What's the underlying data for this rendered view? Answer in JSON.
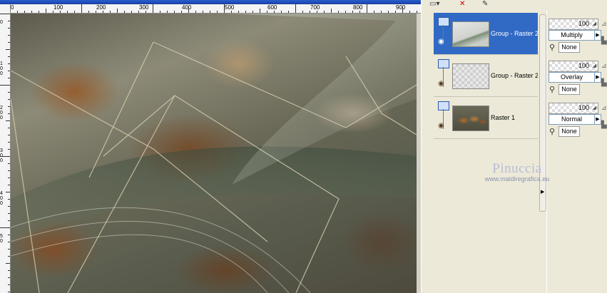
{
  "ruler": {
    "top_labels": [
      "0",
      "100",
      "200",
      "300",
      "400",
      "500",
      "600",
      "700",
      "800",
      "900"
    ],
    "left_labels": [
      "0",
      "1 0 0",
      "2 0 0",
      "3 0 0",
      "4 0 0",
      "5 0"
    ]
  },
  "layers": [
    {
      "name": "Group - Raster 2",
      "selected": true
    },
    {
      "name": "Group - Raster 2",
      "selected": false
    },
    {
      "name": "Raster 1",
      "selected": false
    }
  ],
  "properties": [
    {
      "opacity": "100",
      "blend": "Multiply",
      "mask": "None"
    },
    {
      "opacity": "100",
      "blend": "Overlay",
      "mask": "None"
    },
    {
      "opacity": "100",
      "blend": "Normal",
      "mask": "None"
    }
  ],
  "watermark": {
    "name": "Pinuccia",
    "url": "www.maidiregrafica.eu"
  },
  "colors": {
    "selection": "#316ac5",
    "panel_bg": "#ece9d8",
    "title_bar": "#2a5fd0"
  }
}
